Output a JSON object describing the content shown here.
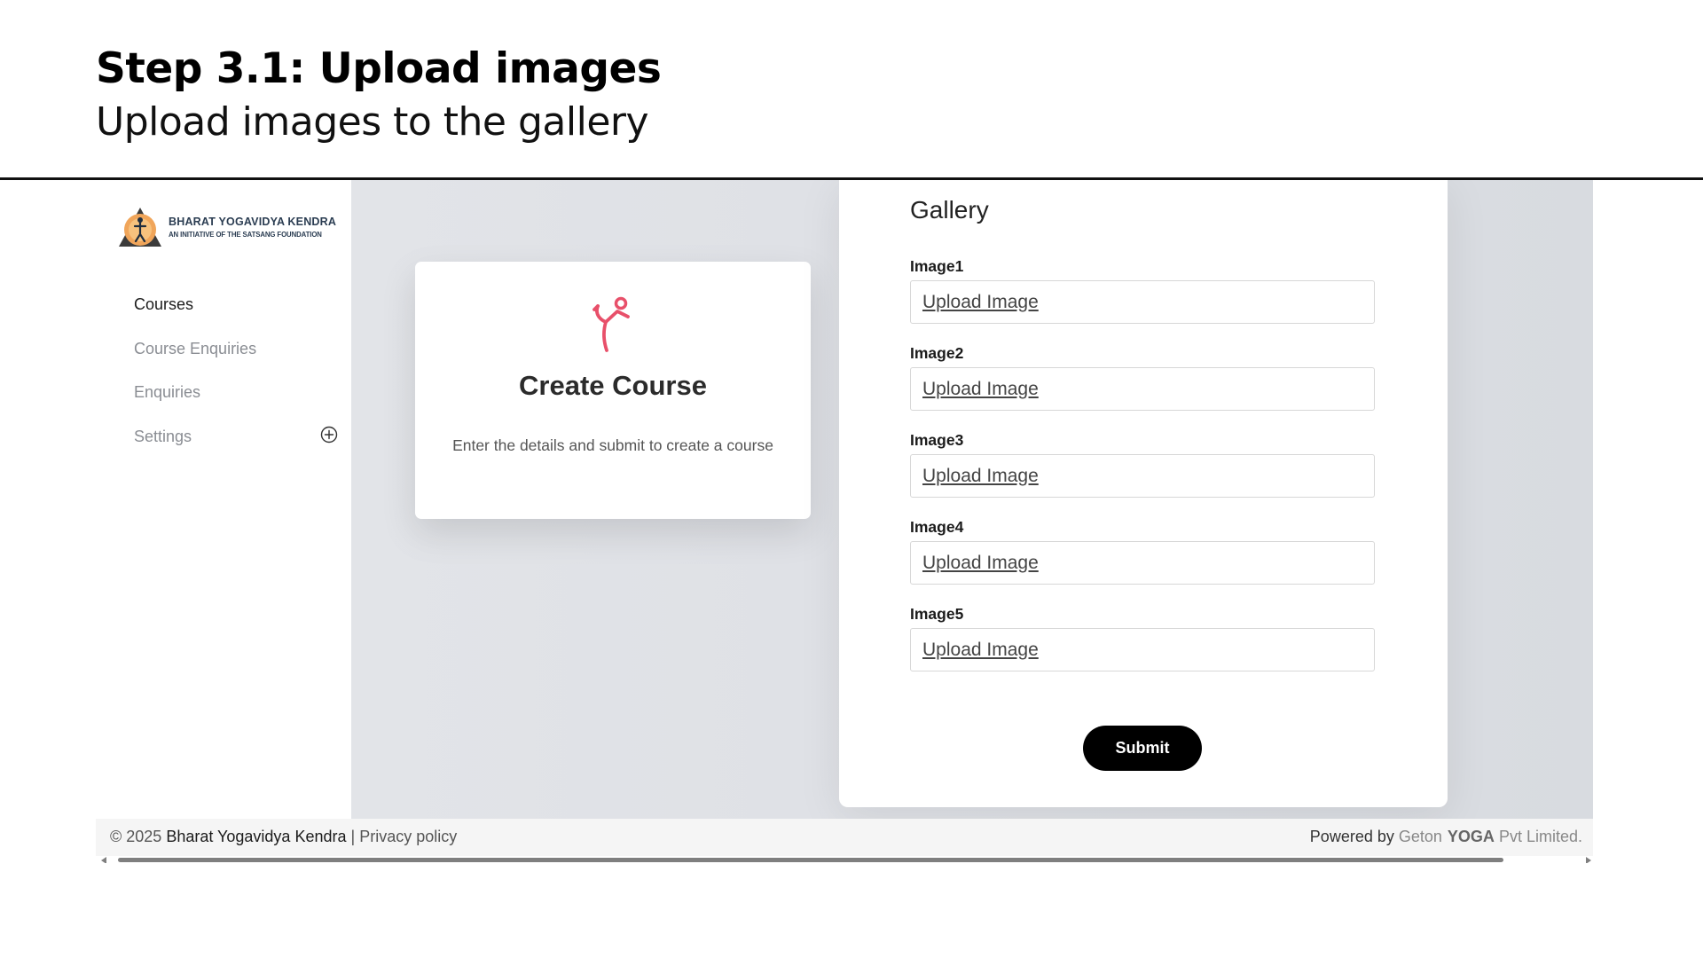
{
  "slide": {
    "title": "Step 3.1: Upload images",
    "subtitle": "Upload images to the gallery"
  },
  "logo": {
    "line1": "BHARAT YOGAVIDYA KENDRA",
    "line2": "AN INITIATIVE OF THE SATSANG FOUNDATION",
    "icon": "yoga-lotus-logo-icon"
  },
  "sidebar": {
    "items": [
      {
        "label": "Courses",
        "active": true
      },
      {
        "label": "Course Enquiries",
        "active": false
      },
      {
        "label": "Enquiries",
        "active": false
      },
      {
        "label": "Settings",
        "active": false,
        "icon": "plus-circle-icon"
      }
    ]
  },
  "create_card": {
    "icon": "yoga-pose-icon",
    "icon_color": "#e8506a",
    "title": "Create Course",
    "description": "Enter the details and submit to create a course"
  },
  "gallery": {
    "title": "Gallery",
    "fields": [
      {
        "label": "Image1",
        "link": "Upload Image"
      },
      {
        "label": "Image2",
        "link": "Upload Image"
      },
      {
        "label": "Image3",
        "link": "Upload Image"
      },
      {
        "label": "Image4",
        "link": "Upload Image"
      },
      {
        "label": "Image5",
        "link": "Upload Image"
      }
    ],
    "submit_label": "Submit"
  },
  "footer": {
    "copyright": "© 2025",
    "brand": "Bharat Yogavidya Kendra",
    "separator": "|",
    "privacy": "Privacy policy",
    "powered_by": "Powered by",
    "geton": "Geton",
    "yoga": "YOGA",
    "pvt": "Pvt Limited."
  }
}
